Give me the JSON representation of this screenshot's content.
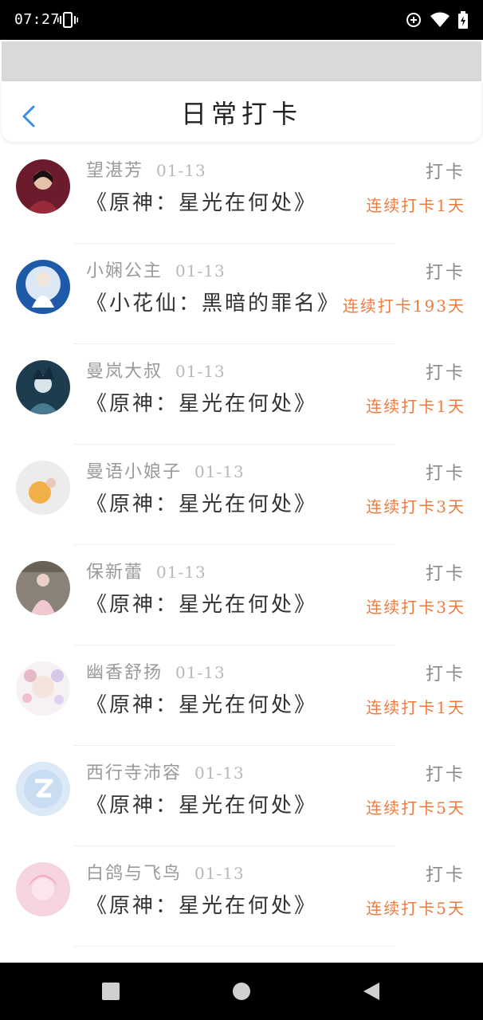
{
  "status_bar": {
    "time": "07:27",
    "icons": [
      "vibrate-icon",
      "data-saver-icon",
      "wifi-icon",
      "battery-icon"
    ]
  },
  "header": {
    "title": "日常打卡",
    "back_icon": "chevron-left-icon",
    "accent_color": "#3a8ee6"
  },
  "checkin_label": "打卡",
  "streak_color": "#ef7a3d",
  "entries": [
    {
      "user": "望湛芳",
      "date": "01-13",
      "book": "《原神：星光在何处》",
      "streak": "连续打卡1天"
    },
    {
      "user": "小娴公主",
      "date": "01-13",
      "book": "《小花仙：黑暗的罪名》",
      "streak": "连续打卡193天"
    },
    {
      "user": "曼岚大叔",
      "date": "01-13",
      "book": "《原神：星光在何处》",
      "streak": "连续打卡1天"
    },
    {
      "user": "曼语小娘子",
      "date": "01-13",
      "book": "《原神：星光在何处》",
      "streak": "连续打卡3天"
    },
    {
      "user": "保新蕾",
      "date": "01-13",
      "book": "《原神：星光在何处》",
      "streak": "连续打卡3天"
    },
    {
      "user": "幽香舒扬",
      "date": "01-13",
      "book": "《原神：星光在何处》",
      "streak": "连续打卡1天"
    },
    {
      "user": "西行寺沛容",
      "date": "01-13",
      "book": "《原神：星光在何处》",
      "streak": "连续打卡5天"
    },
    {
      "user": "白鸽与飞鸟",
      "date": "01-13",
      "book": "《原神：星光在何处》",
      "streak": "连续打卡5天"
    }
  ],
  "nav_bar": {
    "buttons": [
      "recents-square-icon",
      "home-circle-icon",
      "back-triangle-icon"
    ]
  }
}
